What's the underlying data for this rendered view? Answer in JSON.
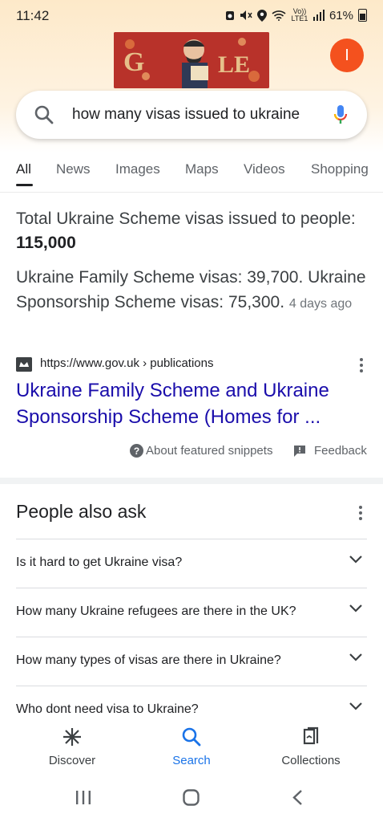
{
  "status": {
    "time": "11:42",
    "lte": "Vo)) LTE1",
    "battery": "61%"
  },
  "account": {
    "initial": "I"
  },
  "doodle": {
    "letters": "G  GLE"
  },
  "search": {
    "query": "how many visas issued to ukraine"
  },
  "tabs": [
    "All",
    "News",
    "Images",
    "Maps",
    "Videos",
    "Shopping"
  ],
  "snippet": {
    "answer_prefix": "Total Ukraine Scheme visas issued to people: ",
    "answer_value": "115,000",
    "detail": "Ukraine Family Scheme visas: 39,700. Ukraine Sponsorship Scheme visas: 75,300.",
    "date": "4 days ago",
    "source_url": "https://www.gov.uk › publications",
    "title": "Ukraine Family Scheme and Ukraine Sponsorship Scheme (Homes for ...",
    "about": "About featured snippets",
    "feedback": "Feedback"
  },
  "paa": {
    "heading": "People also ask",
    "questions": [
      "Is it hard to get Ukraine visa?",
      "How many Ukraine refugees are there in the UK?",
      "How many types of visas are there in Ukraine?",
      "Who dont need visa to Ukraine?"
    ]
  },
  "bottom_nav": {
    "discover": "Discover",
    "search": "Search",
    "collections": "Collections"
  },
  "colors": {
    "link": "#1a0dab",
    "accent": "#1a73e8",
    "avatar": "#f4511e"
  }
}
